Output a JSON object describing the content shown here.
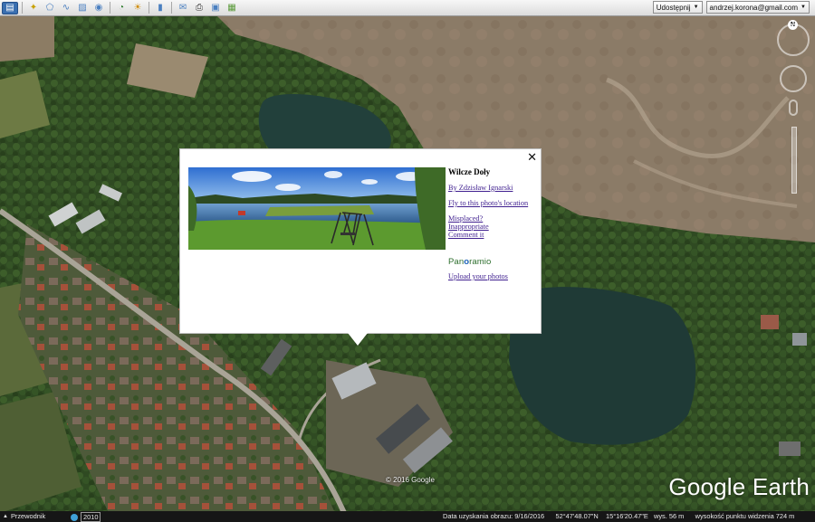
{
  "toolbar": {
    "share_label": "Udostępnij",
    "account_label": "andrzej.korona@gmail.com"
  },
  "nav": {
    "north_label": "N"
  },
  "balloon": {
    "title": "Wilcze Doły",
    "author": "By Zdzisław Ignarski",
    "fly_to": "Fly to this photo's location",
    "misplaced": "Misplaced?",
    "inappropriate": "Inappropriate",
    "comment": "Comment it",
    "brand_a": "Pan",
    "brand_o": "o",
    "brand_b": "ramio",
    "upload": "Upload your photos",
    "close": "✕"
  },
  "map": {
    "copyright": "© 2016 Google",
    "logo": "Google Earth"
  },
  "statusbar": {
    "guide_label": "Przewodnik",
    "year": "2010",
    "imagery_date": "Data uzyskania obrazu: 9/16/2016",
    "latitude": "52°47'48.07\"N",
    "longitude": "15°16'20.47\"E",
    "elevation": "wys.   56 m",
    "eye_altitude": "wysokość punktu widzenia   724 m"
  },
  "colors": {
    "toolbar_accent": "#3a6fb0",
    "link": "#3f1f8f",
    "water": "#1f3a36",
    "field": "#8a7a66"
  }
}
